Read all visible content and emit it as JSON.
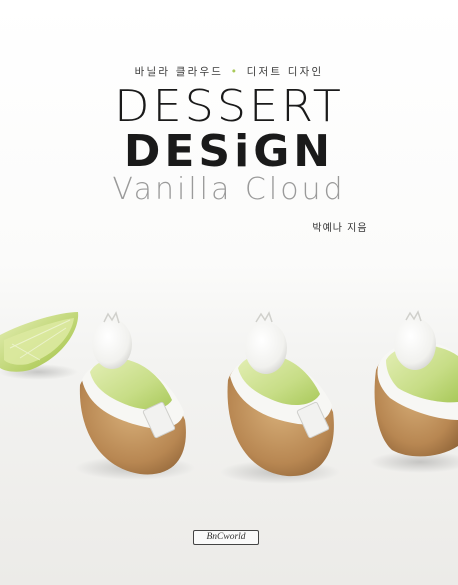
{
  "cover": {
    "subtitle_left": "바닐라 클라우드",
    "subtitle_sep": "•",
    "subtitle_right": "디저트 디자인",
    "title_line1": "DESSERT",
    "title_line2": "DESiGN",
    "title_line3": "Vanilla Cloud",
    "author": "박예나 지음",
    "publisher": "BnCworld"
  },
  "colors": {
    "lime": "#c7dd86",
    "lime_dark": "#a9c95a",
    "crust": "#c49a63",
    "title": "#1a1a1a",
    "title_light": "#9a9a9a"
  }
}
